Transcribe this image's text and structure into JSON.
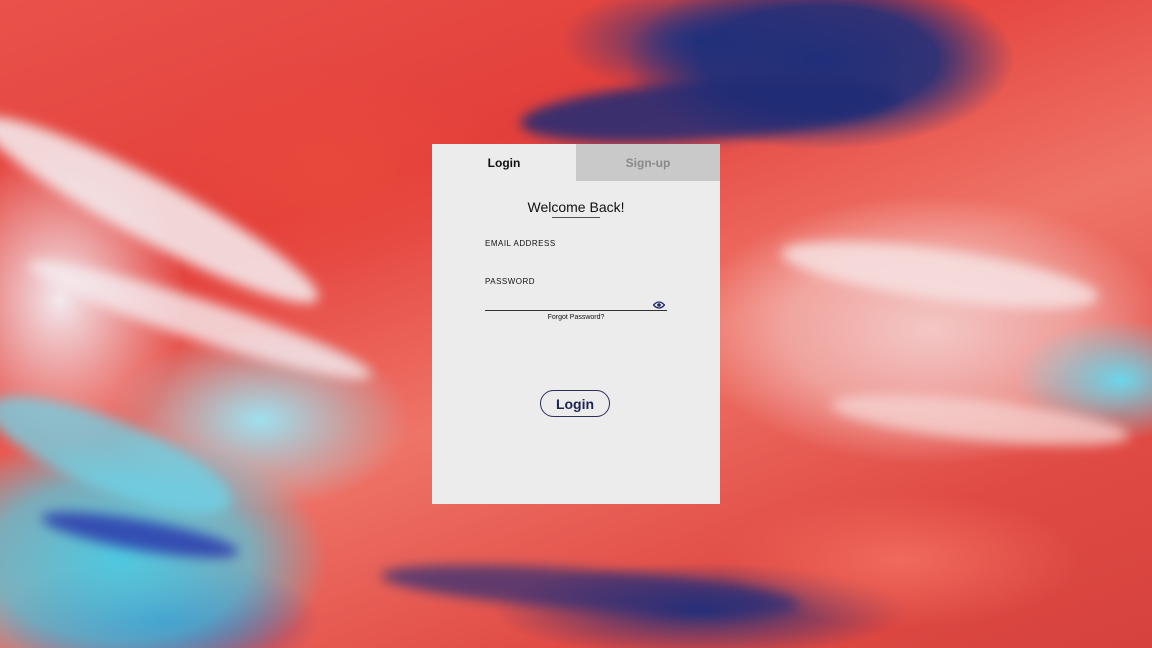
{
  "tabs": {
    "login": "Login",
    "signup": "Sign-up"
  },
  "heading": "Welcome Back!",
  "email": {
    "label": "EMAIL ADDRESS",
    "value": ""
  },
  "password": {
    "label": "PASSWORD",
    "value": ""
  },
  "forgot": "Forgot Password?",
  "submit": "Login",
  "icons": {
    "password_toggle": "eye-icon"
  },
  "colors": {
    "card": "#ececec",
    "inactive_tab": "#c9c9c9",
    "button_text": "#1e2450",
    "eye_icon": "#1e2a6a"
  }
}
